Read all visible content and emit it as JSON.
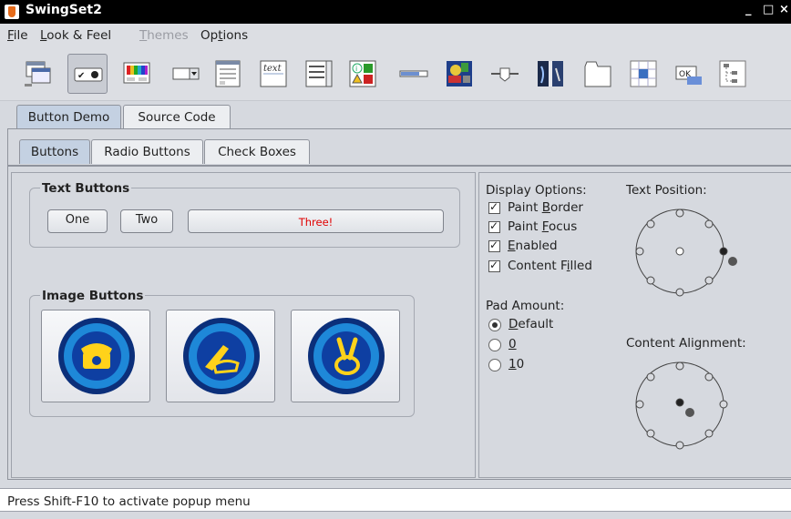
{
  "window": {
    "title": "SwingSet2",
    "minimize": "_",
    "maximize": "□",
    "close": "×"
  },
  "menu": {
    "file": {
      "pre": "",
      "u": "F",
      "post": "ile"
    },
    "laf": {
      "pre": "",
      "u": "L",
      "post": "ook & Feel"
    },
    "themes": {
      "pre": "",
      "u": "T",
      "post": "hemes"
    },
    "options": {
      "pre": "Op",
      "u": "t",
      "post": "ions"
    }
  },
  "toolbar": {
    "items": [
      "internal-frame-demo",
      "button-demo",
      "color-chooser-demo",
      "combobox-demo",
      "file-chooser-demo",
      "editor-pane-demo",
      "list-demo",
      "option-pane-demo",
      "progress-bar-demo",
      "scroll-pane-demo",
      "slider-demo",
      "split-pane-demo",
      "tabbed-pane-demo",
      "table-demo",
      "tooltip-demo",
      "tree-demo"
    ],
    "selected": "button-demo",
    "text_icon_label": "text",
    "ok_label": "OK"
  },
  "outer_tabs": [
    "Button Demo",
    "Source Code"
  ],
  "inner_tabs": [
    "Buttons",
    "Radio Buttons",
    "Check Boxes"
  ],
  "text_buttons": {
    "title": "Text Buttons",
    "one": "One",
    "two": "Two",
    "three": "Three!"
  },
  "image_buttons": {
    "title": "Image Buttons",
    "icons": [
      "phone-icon",
      "pen-icon",
      "peace-hand-icon"
    ]
  },
  "display_options": {
    "title": "Display Options:",
    "items": [
      {
        "pre": "Paint ",
        "u": "B",
        "post": "order",
        "checked": true
      },
      {
        "pre": "Paint ",
        "u": "F",
        "post": "ocus",
        "checked": true
      },
      {
        "pre": "",
        "u": "E",
        "post": "nabled",
        "checked": true
      },
      {
        "pre": "Content F",
        "u": "i",
        "post": "lled",
        "checked": true
      }
    ]
  },
  "pad_amount": {
    "title": "Pad Amount:",
    "options": [
      {
        "pre": "",
        "u": "D",
        "post": "efault",
        "selected": true
      },
      {
        "pre": "",
        "u": "0",
        "post": "",
        "selected": false
      },
      {
        "pre": "",
        "u": "1",
        "post": "0",
        "selected": false
      }
    ]
  },
  "text_position": {
    "title": "Text Position:"
  },
  "content_alignment": {
    "title": "Content Alignment:"
  },
  "status": {
    "text": "Press Shift-F10 to activate popup menu"
  },
  "colors": {
    "tab_selected": "#c4d1e2",
    "three_text": "#e00000",
    "accent": "#1b5fb0"
  }
}
